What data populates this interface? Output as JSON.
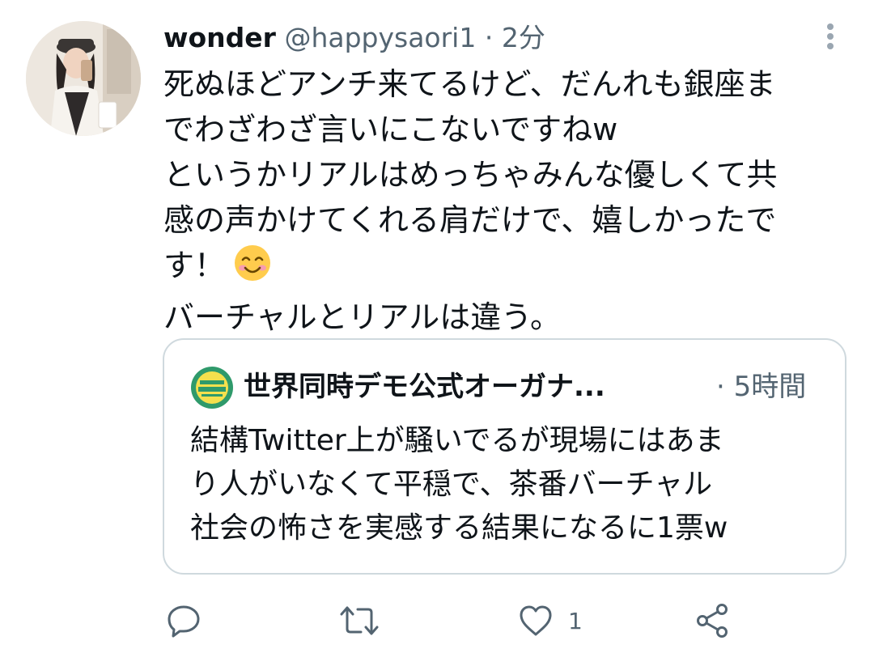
{
  "tweet": {
    "author_name": "wonder",
    "handle": "@happysaori1",
    "separator": "·",
    "time": "2分",
    "text_lines": [
      "死ぬほどアンチ来てるけど、だんれも銀座ま",
      "でわざわざ言いにこないですねw",
      "というかリアルはめっちゃみんな優しくて共",
      "感の声かけてくれる肩だけで、嬉しかったで",
      "す！",
      "バーチャルとリアルは違う。"
    ]
  },
  "quoted_tweet": {
    "author_name": "世界同時デモ公式オーガナ...",
    "time": "· 5時間",
    "text_lines": [
      "結構Twitter上が騒いでるが現場にはあま",
      "り人がいなくて平穏で、茶番バーチャル",
      "社会の怖さを実感する結果になるに1票w"
    ]
  },
  "actions": {
    "reply_icon": "reply-icon",
    "retweet_icon": "retweet-icon",
    "like_icon": "heart-icon",
    "like_count": "1",
    "share_icon": "share-icon"
  },
  "colors": {
    "text_primary": "#0f1419",
    "text_secondary": "#536471",
    "border": "#cfd9de",
    "emoji_face": "#ffcc4d"
  }
}
